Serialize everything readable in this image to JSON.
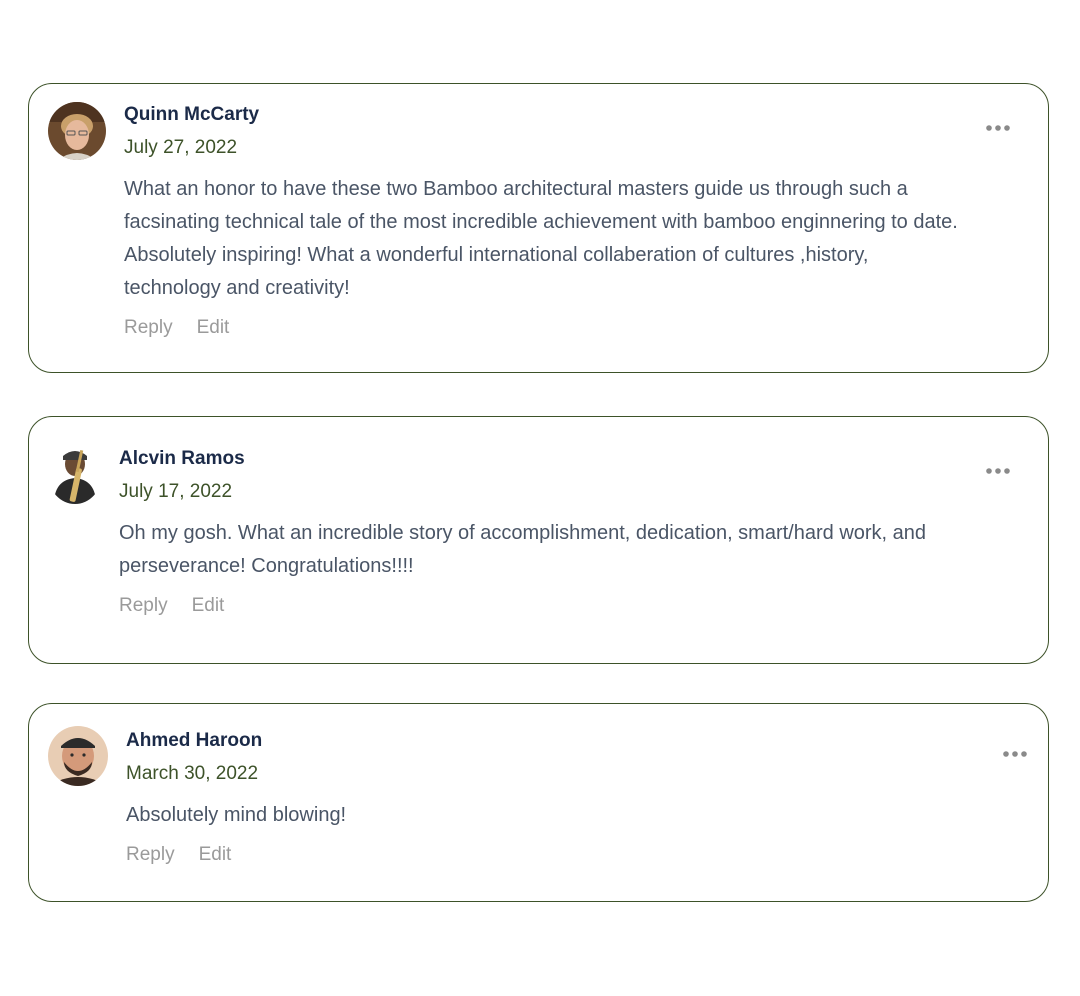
{
  "comments": [
    {
      "author": "Quinn McCarty",
      "date": "July 27, 2022",
      "text": "What an honor to have these two Bamboo architectural masters guide us through such a\nfacsinating technical tale of the most incredible achievement with bamboo enginnering to date.\nAbsolutely inspiring! What a wonderful international collaberation of cultures ,history,\ntechnology and creativity!",
      "reply_label": "Reply",
      "edit_label": "Edit",
      "avatar_icon": "user-photo-icon",
      "more_icon": "more-options-icon"
    },
    {
      "author": "Alcvin Ramos",
      "date": "July 17, 2022",
      "text": "Oh my gosh. What an incredible story of accomplishment, dedication, smart/hard work, and\nperseverance! Congratulations!!!!",
      "reply_label": "Reply",
      "edit_label": "Edit",
      "avatar_icon": "user-photo-icon",
      "more_icon": "more-options-icon"
    },
    {
      "author": "Ahmed Haroon",
      "date": "March 30, 2022",
      "text": "Absolutely mind blowing!",
      "reply_label": "Reply",
      "edit_label": "Edit",
      "avatar_icon": "user-photo-icon",
      "more_icon": "more-options-icon"
    }
  ],
  "colors": {
    "card_border": "#3d5229",
    "author": "#1b2a48",
    "date": "#3d5229",
    "body_text": "#4a5566",
    "action_text": "#9a9a9a"
  }
}
